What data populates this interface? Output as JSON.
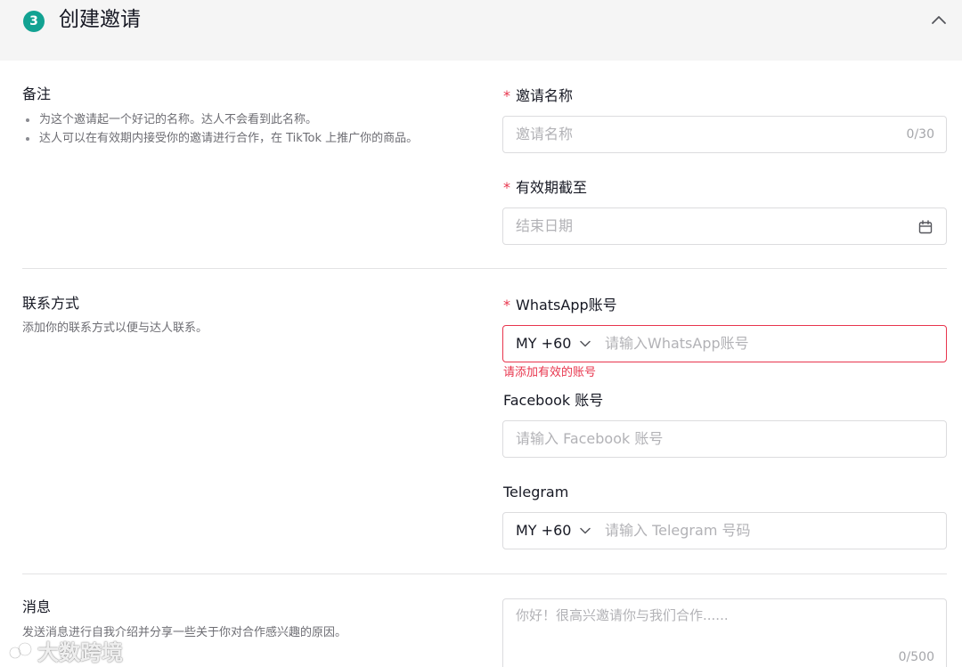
{
  "header": {
    "step_number": "3",
    "title": "创建邀请"
  },
  "notes_section": {
    "title": "备注",
    "bullets": [
      "为这个邀请起一个好记的名称。达人不会看到此名称。",
      "达人可以在有效期内接受你的邀请进行合作，在 TikTok 上推广你的商品。"
    ]
  },
  "invite_name": {
    "label": "邀请名称",
    "placeholder": "邀请名称",
    "counter": "0/30"
  },
  "expiry": {
    "label": "有效期截至",
    "placeholder": "结束日期"
  },
  "contact_section": {
    "title": "联系方式",
    "description": "添加你的联系方式以便与达人联系。"
  },
  "whatsapp": {
    "label": "WhatsApp账号",
    "country_code": "MY +60",
    "placeholder": "请输入WhatsApp账号",
    "error": "请添加有效的账号"
  },
  "facebook": {
    "label": "Facebook 账号",
    "placeholder": "请输入 Facebook 账号"
  },
  "telegram": {
    "label": "Telegram",
    "country_code": "MY +60",
    "placeholder": "请输入 Telegram 号码"
  },
  "message_section": {
    "title": "消息",
    "description": "发送消息进行自我介绍并分享一些关于你对合作感兴趣的原因。"
  },
  "message": {
    "placeholder": "你好！很高兴邀请你与我们合作......",
    "counter": "0/500"
  },
  "watermark": {
    "text": "大数跨境"
  },
  "required_mark": "*",
  "colors": {
    "accent": "#12a292",
    "error": "#e8354d",
    "header_bg": "#f5f5f5"
  }
}
